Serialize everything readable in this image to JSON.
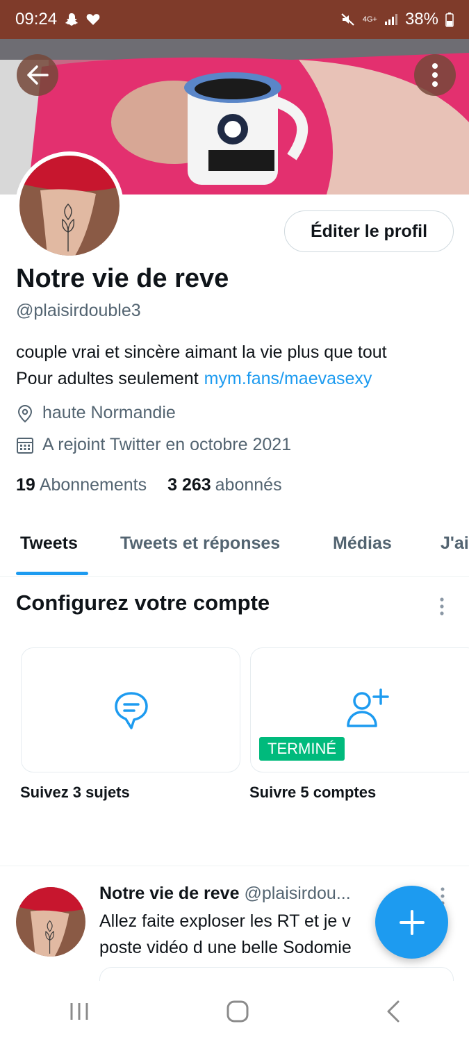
{
  "status_bar": {
    "time": "09:24",
    "network": "4G+",
    "battery": "38%",
    "bg_color": "#7f3b2a"
  },
  "profile": {
    "name": "Notre vie de reve",
    "handle": "@plaisirdouble3",
    "bio_line1": "couple vrai et sincère aimant la vie plus que tout",
    "bio_line2": "Pour adultes seulement",
    "bio_link": "mym.fans/maevasexy",
    "location": "haute Normandie",
    "joined": "A rejoint Twitter en octobre 2021",
    "following_count": "19",
    "following_label": "Abonnements",
    "followers_count": "3 263",
    "followers_label": "abonnés",
    "edit_button": "Éditer le profil"
  },
  "tabs": [
    {
      "label": "Tweets",
      "active": true
    },
    {
      "label": "Tweets et réponses",
      "active": false
    },
    {
      "label": "Médias",
      "active": false
    },
    {
      "label": "J'ai",
      "active": false
    }
  ],
  "setup": {
    "title": "Configurez votre compte",
    "cards": [
      {
        "label": "Suivez 3 sujets",
        "icon": "topic-bubble-icon",
        "done": false
      },
      {
        "label": "Suivre 5 comptes",
        "icon": "add-user-icon",
        "done": true,
        "badge": "TERMINÉ"
      }
    ]
  },
  "tweet": {
    "author": "Notre vie de reve",
    "handle": "@plaisirdou...",
    "text_line1": "Allez faite exploser les RT et je v",
    "text_line2": "poste vidéo d une belle Sodomie"
  },
  "colors": {
    "accent": "#1d9bf0",
    "done": "#00ba7c",
    "secondary_text": "#536471"
  }
}
